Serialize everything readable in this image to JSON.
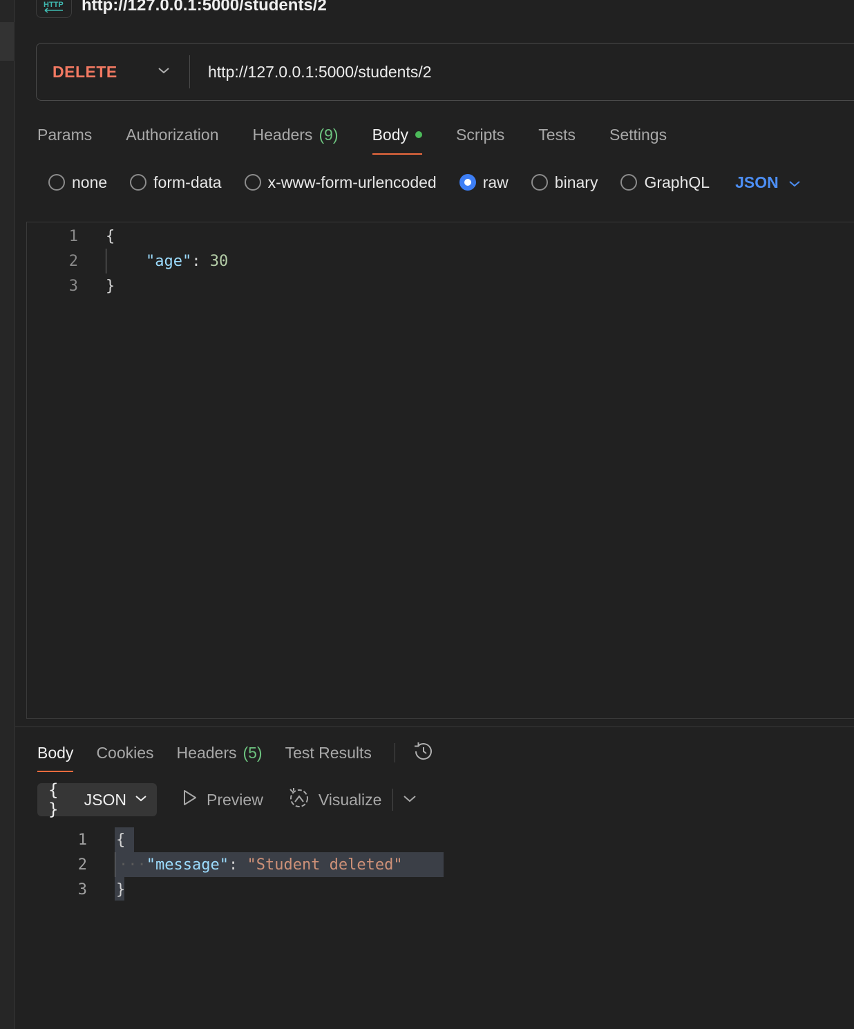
{
  "request": {
    "title": "http://127.0.0.1:5000/students/2",
    "method": "DELETE",
    "url": "http://127.0.0.1:5000/students/2"
  },
  "request_tabs": [
    {
      "label": "Params"
    },
    {
      "label": "Authorization"
    },
    {
      "label": "Headers",
      "count": "(9)"
    },
    {
      "label": "Body"
    },
    {
      "label": "Scripts"
    },
    {
      "label": "Tests"
    },
    {
      "label": "Settings"
    }
  ],
  "body_types": [
    {
      "label": "none"
    },
    {
      "label": "form-data"
    },
    {
      "label": "x-www-form-urlencoded"
    },
    {
      "label": "raw"
    },
    {
      "label": "binary"
    },
    {
      "label": "GraphQL"
    }
  ],
  "body_format": "JSON",
  "request_body": {
    "line_numbers": [
      "1",
      "2",
      "3"
    ],
    "open_brace": "{",
    "key": "\"age\"",
    "colon": ": ",
    "value": "30",
    "close_brace": "}"
  },
  "response_tabs": [
    {
      "label": "Body"
    },
    {
      "label": "Cookies"
    },
    {
      "label": "Headers",
      "count": "(5)"
    },
    {
      "label": "Test Results"
    }
  ],
  "response_toolbar": {
    "format_brace": "{ }",
    "format_label": "JSON",
    "preview_label": "Preview",
    "visualize_label": "Visualize"
  },
  "response_body": {
    "line_numbers": [
      "1",
      "2",
      "3"
    ],
    "open_brace": "{",
    "indent_dots": "···",
    "key": "\"message\"",
    "colon": ":",
    "value": "\"Student deleted\"",
    "close_brace": "}"
  },
  "colors": {
    "method_delete": "#f27962",
    "accent_tab": "#ef6b3e",
    "radio_checked": "#3d7ef5",
    "json_selector": "#4d8ff5",
    "count_green": "#6cc17e",
    "dot_green": "#4cba5a"
  }
}
